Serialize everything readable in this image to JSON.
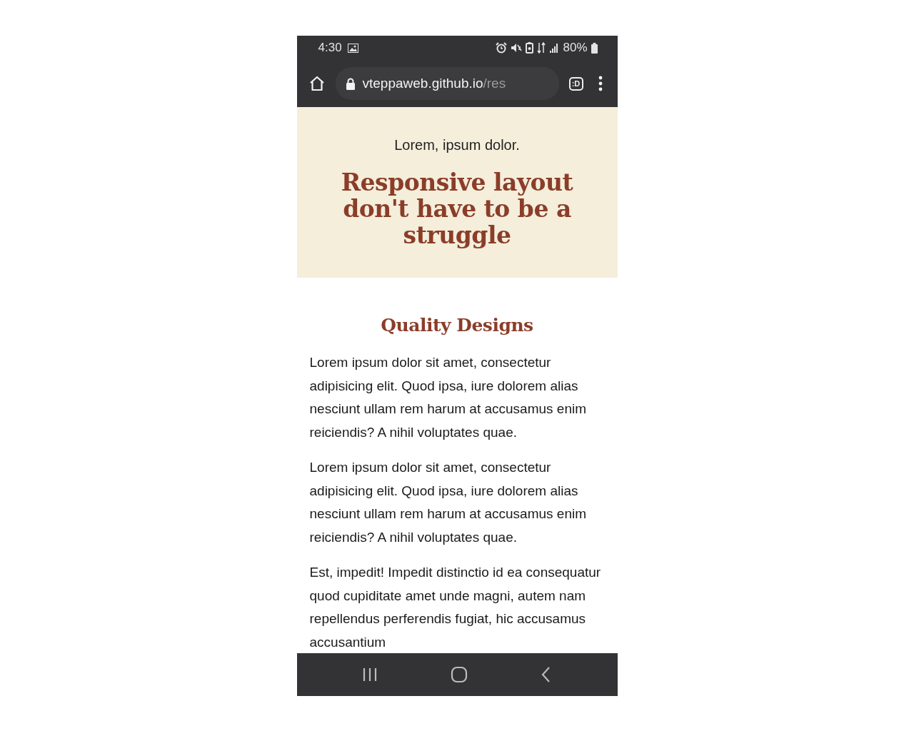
{
  "status_bar": {
    "time": "4:30",
    "battery": "80%"
  },
  "address_bar": {
    "host": "vteppaweb.github.io",
    "path": "/res",
    "tab_button": ":D"
  },
  "hero": {
    "kicker": "Lorem, ipsum dolor.",
    "title": "Responsive layout don't have to be a struggle"
  },
  "section": {
    "heading": "Quality Designs",
    "paragraphs": [
      "Lorem ipsum dolor sit amet, consectetur adipisicing elit. Quod ipsa, iure dolorem alias nesciunt ullam rem harum at accusamus enim reiciendis? A nihil voluptates quae.",
      "Lorem ipsum dolor sit amet, consectetur adipisicing elit. Quod ipsa, iure dolorem alias nesciunt ullam rem harum at accusamus enim reiciendis? A nihil voluptates quae.",
      "Est, impedit! Impedit distinctio id ea consequatur quod cupiditate amet unde magni, autem nam repellendus perferendis fugiat, hic accusamus accusantium"
    ]
  }
}
